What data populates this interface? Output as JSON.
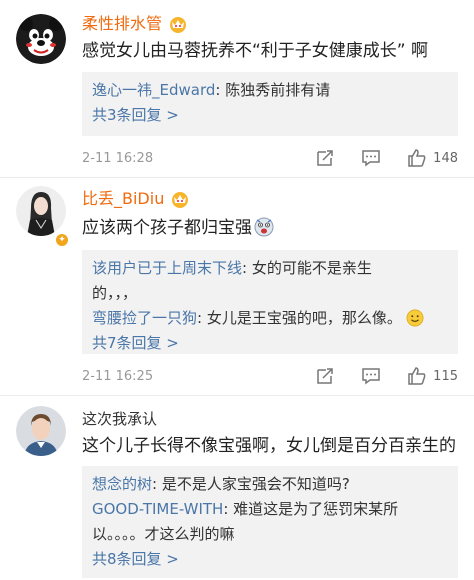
{
  "comments": [
    {
      "user": "柔性排水管",
      "text": "感觉女儿由马蓉抚养不“利于子女健康成长” 啊",
      "replies": [
        {
          "user": "逸心一祎_Edward",
          "text": "陈独秀前排有请"
        }
      ],
      "more": "共3条回复 >",
      "time": "2-11 16:28",
      "likes": "148"
    },
    {
      "user": "比丢_BiDiu",
      "text": "应该两个孩子都归宝强",
      "replies": [
        {
          "user": "该用户已于上周末下线",
          "text": "女的可能不是亲生",
          "text2": "的，，，"
        },
        {
          "user": "弯腰捡了一只狗",
          "text": "女儿是王宝强的吧，那么像。"
        }
      ],
      "more": "共7条回复 >",
      "time": "2-11 16:25",
      "likes": "115"
    },
    {
      "user": "这次我承认",
      "text": "这个儿子长得不像宝强啊，女儿倒是百分百亲生的",
      "replies": [
        {
          "user": "想念的树",
          "text": "是不是人家宝强会不知道吗?"
        },
        {
          "user": "GOOD-TIME-WITH",
          "text": "难道这是为了惩罚宋某所",
          "text2": "以。。。。才这么判的嘛"
        }
      ],
      "more": "共8条回复 >"
    }
  ],
  "colors": {
    "username": "#f06b0f",
    "link": "#4a76a8",
    "reply_bg": "#f2f2f2"
  },
  "icons": [
    "crown-icon",
    "share-icon",
    "comment-icon",
    "like-icon",
    "smile-emoji",
    "scared-emoji",
    "vip-badge"
  ]
}
